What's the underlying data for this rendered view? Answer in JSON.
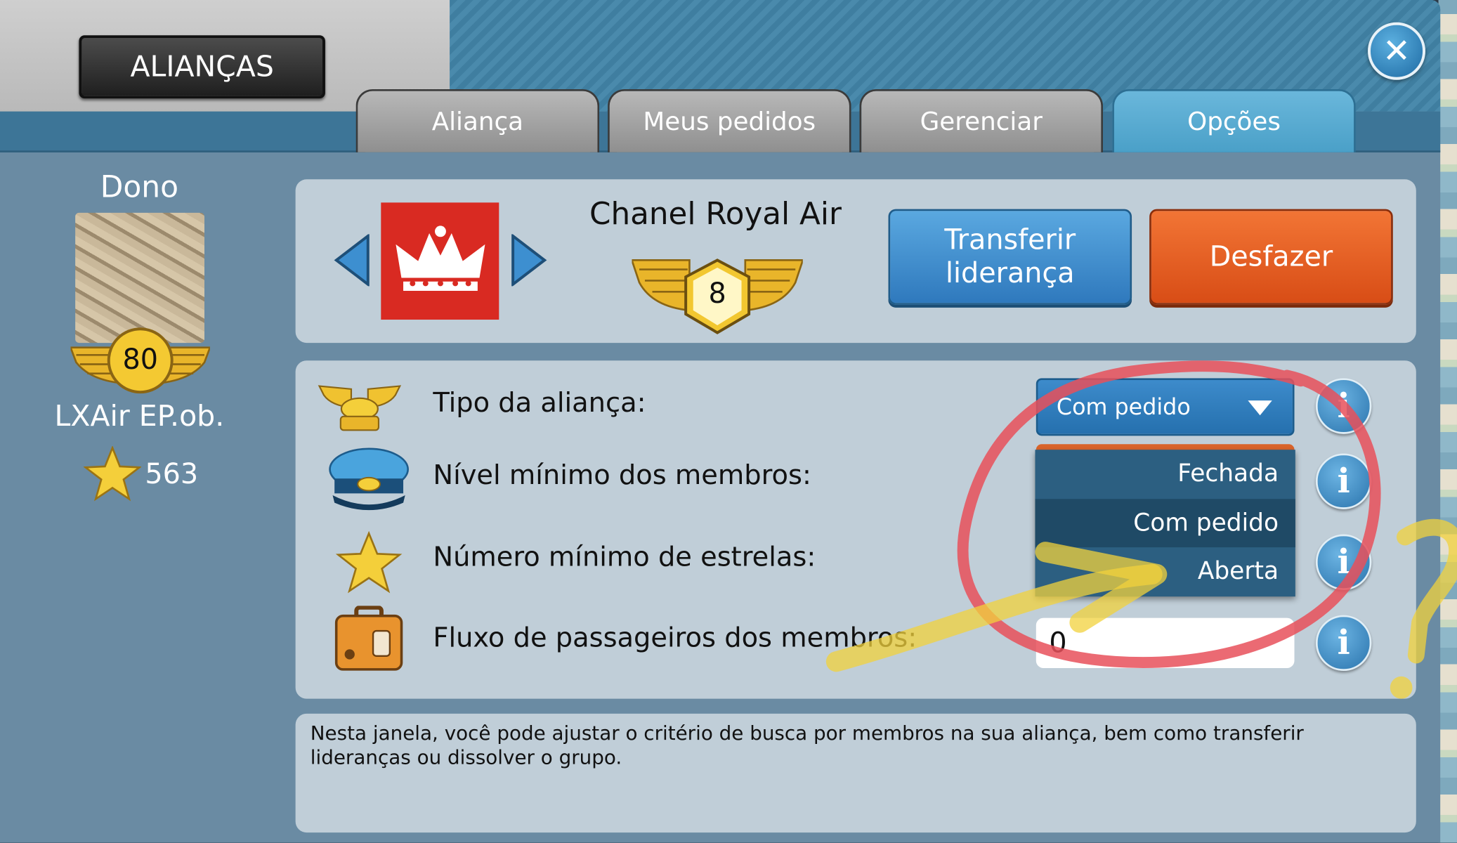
{
  "window": {
    "title": "ALIANÇAS",
    "close_glyph": "✕"
  },
  "tabs": [
    {
      "label": "Aliança",
      "active": false
    },
    {
      "label": "Meus pedidos",
      "active": false
    },
    {
      "label": "Gerenciar",
      "active": false
    },
    {
      "label": "Opções",
      "active": true
    }
  ],
  "owner": {
    "label": "Dono",
    "level": "80",
    "name": "LXAir EP.ob.",
    "stars": "563"
  },
  "alliance": {
    "name": "Chanel Royal Air",
    "level": "8",
    "logo_color": "#d92a22"
  },
  "actions": {
    "transfer_label": "Transferir liderança",
    "undo_label": "Desfazer"
  },
  "settings": {
    "type_label": "Tipo da aliança:",
    "type_value": "Com pedido",
    "min_level_label": "Nível mínimo dos membros:",
    "min_stars_label": "Número mínimo de estrelas:",
    "passenger_flow_label": "Fluxo de passageiros dos membros:",
    "passenger_flow_value": "0",
    "info_glyph": "i"
  },
  "dropdown": {
    "options": [
      "Fechada",
      "Com pedido",
      "Aberta"
    ],
    "selected": "Com pedido"
  },
  "description": "Nesta janela, você pode ajustar o critério de busca por membros na sua aliança, bem como transferir lideranças ou dissolver o grupo.",
  "colors": {
    "accent_blue": "#2f79bd",
    "undo_orange": "#d84d16",
    "annotation_red": "#e8505b",
    "annotation_yellow": "#f2d23c"
  },
  "icons": {
    "type_row": "pilot-wings-icon",
    "level_row": "pilot-cap-icon",
    "stars_row": "star-icon",
    "passengers_row": "suitcase-icon"
  }
}
